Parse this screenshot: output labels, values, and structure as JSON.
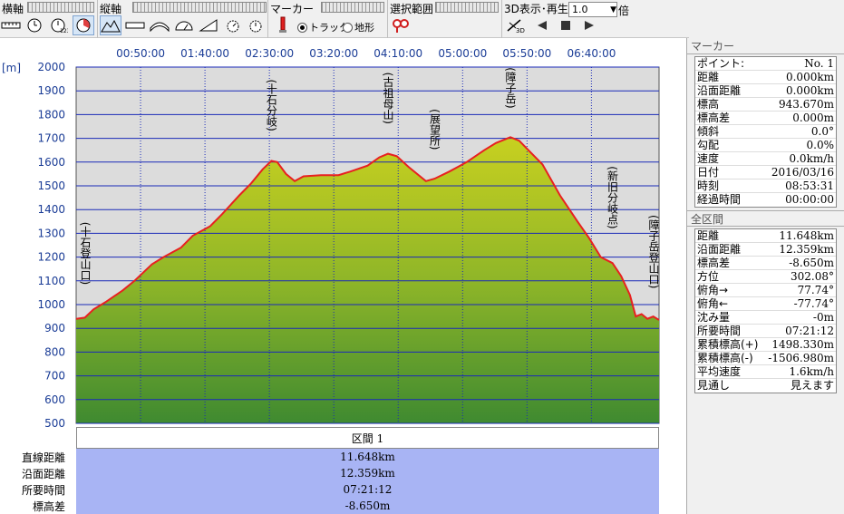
{
  "toolbar": {
    "horizontal_axis_label": "横軸",
    "vertical_axis_label": "縦軸",
    "marker_label": "マーカー",
    "track_label": "トラック",
    "terrain_label": "地形",
    "selection_label": "選択範囲",
    "playback_label": "3D表示･再生",
    "speed_value": "1.0",
    "speed_unit": "倍"
  },
  "chart": {
    "unit_label": "[m]",
    "time_ticks": [
      "00:50:00",
      "01:40:00",
      "02:30:00",
      "03:20:00",
      "04:10:00",
      "05:00:00",
      "05:50:00",
      "06:40:00"
    ],
    "elevation_ticks": [
      "2000",
      "1900",
      "1800",
      "1700",
      "1600",
      "1500",
      "1400",
      "1300",
      "1200",
      "1100",
      "1000",
      "900",
      "800",
      "700",
      "600",
      "500"
    ],
    "waypoints": [
      {
        "label": "十石登山口",
        "x": 0,
        "y": 955
      },
      {
        "label": "十石分岐",
        "x": 0.335,
        "y": 1605
      },
      {
        "label": "古祖母山",
        "x": 0.535,
        "y": 1635
      },
      {
        "label": "展望所",
        "x": 0.615,
        "y": 1530
      },
      {
        "label": "障子岳",
        "x": 0.745,
        "y": 1705
      },
      {
        "label": "新旧分岐点",
        "x": 0.92,
        "y": 1190
      },
      {
        "label": "障子岳登山口",
        "x": 1,
        "y": 935
      }
    ]
  },
  "chart_data": {
    "type": "area",
    "xlabel": "",
    "ylabel": "[m]",
    "ylim": [
      500,
      2000
    ],
    "x_ticks": [
      "00:50:00",
      "01:40:00",
      "02:30:00",
      "03:20:00",
      "04:10:00",
      "05:00:00",
      "05:50:00",
      "06:40:00"
    ],
    "series": [
      {
        "values_x": [
          0,
          0.015,
          0.03,
          0.05,
          0.08,
          0.1,
          0.13,
          0.15,
          0.18,
          0.2,
          0.23,
          0.25,
          0.28,
          0.3,
          0.32,
          0.335,
          0.345,
          0.36,
          0.375,
          0.39,
          0.42,
          0.45,
          0.47,
          0.5,
          0.52,
          0.535,
          0.55,
          0.57,
          0.6,
          0.615,
          0.64,
          0.67,
          0.7,
          0.72,
          0.745,
          0.76,
          0.78,
          0.8,
          0.83,
          0.86,
          0.88,
          0.9,
          0.92,
          0.935,
          0.95,
          0.96,
          0.97,
          0.98,
          0.99,
          1.0
        ],
        "values_y": [
          940,
          945,
          980,
          1010,
          1060,
          1100,
          1170,
          1200,
          1240,
          1290,
          1330,
          1380,
          1460,
          1510,
          1570,
          1605,
          1600,
          1550,
          1520,
          1540,
          1545,
          1545,
          1560,
          1585,
          1620,
          1635,
          1625,
          1580,
          1520,
          1530,
          1560,
          1600,
          1650,
          1680,
          1705,
          1690,
          1640,
          1590,
          1460,
          1350,
          1280,
          1200,
          1175,
          1120,
          1040,
          950,
          960,
          940,
          950,
          935
        ]
      }
    ]
  },
  "summary": {
    "section_title": "区間 1",
    "rows": [
      {
        "label": "直線距離",
        "value": "11.648km"
      },
      {
        "label": "沿面距離",
        "value": "12.359km"
      },
      {
        "label": "所要時間",
        "value": "07:21:12"
      },
      {
        "label": "標高差",
        "value": "-8.650m"
      }
    ]
  },
  "marker_panel": {
    "title": "マーカー",
    "rows": [
      {
        "label": "ポイント:",
        "value": "No. 1"
      },
      {
        "label": "距離",
        "value": "0.000km"
      },
      {
        "label": "沿面距離",
        "value": "0.000km"
      },
      {
        "label": "標高",
        "value": "943.670m"
      },
      {
        "label": "標高差",
        "value": "0.000m"
      },
      {
        "label": "傾斜",
        "value": "0.0°"
      },
      {
        "label": "勾配",
        "value": "0.0%"
      },
      {
        "label": "速度",
        "value": "0.0km/h"
      },
      {
        "label": "日付",
        "value": "2016/03/16"
      },
      {
        "label": "時刻",
        "value": "08:53:31"
      },
      {
        "label": "経過時間",
        "value": "00:00:00"
      }
    ]
  },
  "range_panel": {
    "title": "全区間",
    "rows": [
      {
        "label": "距離",
        "value": "11.648km"
      },
      {
        "label": "沿面距離",
        "value": "12.359km"
      },
      {
        "label": "標高差",
        "value": "-8.650m"
      },
      {
        "label": "方位",
        "value": "302.08°"
      },
      {
        "label": "俯角→",
        "value": "77.74°"
      },
      {
        "label": "俯角←",
        "value": "-77.74°"
      },
      {
        "label": "沈み量",
        "value": "-0m"
      },
      {
        "label": "所要時間",
        "value": "07:21:12"
      },
      {
        "label": "累積標高(+)",
        "value": "1498.330m"
      },
      {
        "label": "累積標高(-)",
        "value": "-1506.980m"
      },
      {
        "label": "平均速度",
        "value": "1.6km/h"
      },
      {
        "label": "見通し",
        "value": "見えます"
      }
    ]
  }
}
